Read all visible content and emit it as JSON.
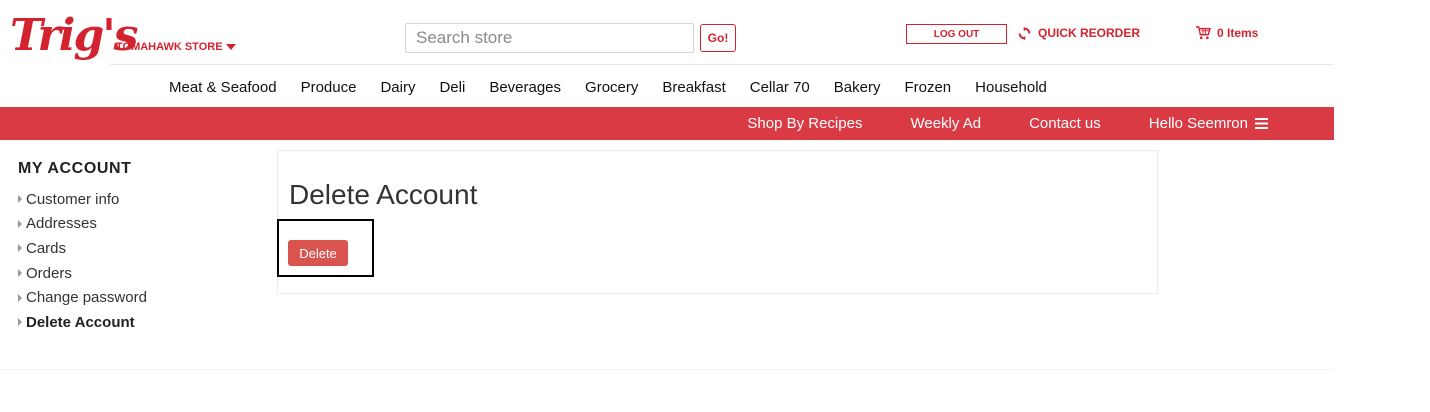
{
  "header": {
    "logo_text": "Trig's",
    "store_name": "TOMAHAWK STORE",
    "search_placeholder": "Search store",
    "go_label": "Go!",
    "logout_label": "LOG OUT",
    "quick_reorder_label": "QUICK REORDER",
    "cart_label": "0 Items"
  },
  "categories": [
    "Meat & Seafood",
    "Produce",
    "Dairy",
    "Deli",
    "Beverages",
    "Grocery",
    "Breakfast",
    "Cellar 70",
    "Bakery",
    "Frozen",
    "Household"
  ],
  "redbar": {
    "recipes": "Shop By Recipes",
    "weekly_ad": "Weekly Ad",
    "contact": "Contact us",
    "hello": "Hello Seemron"
  },
  "sidebar": {
    "title": "MY ACCOUNT",
    "items": [
      "Customer info",
      "Addresses",
      "Cards",
      "Orders",
      "Change password",
      "Delete Account"
    ]
  },
  "main": {
    "heading": "Delete Account",
    "delete_label": "Delete"
  },
  "colors": {
    "brand_red": "#d3232f",
    "bar_red": "#d93a44",
    "button_red": "#d9534f"
  }
}
